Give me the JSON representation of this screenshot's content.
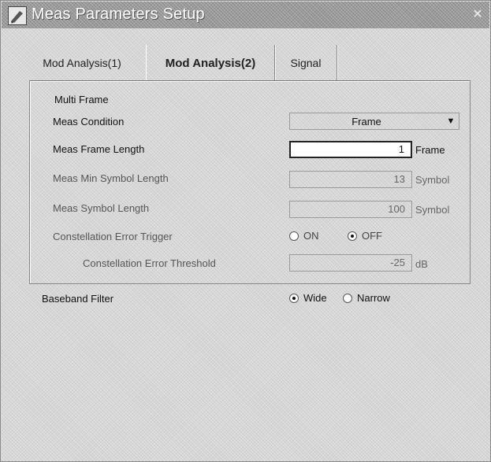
{
  "window": {
    "title": "Meas Parameters Setup",
    "close_glyph": "✕"
  },
  "tabs": [
    {
      "label": "Mod Analysis(1)"
    },
    {
      "label": "Mod Analysis(2)",
      "active": true
    },
    {
      "label": "Signal"
    }
  ],
  "group": {
    "title": "Multi Frame",
    "meas_condition": {
      "label": "Meas Condition",
      "value": "Frame"
    },
    "frame_length": {
      "label": "Meas Frame Length",
      "value": "1",
      "unit": "Frame"
    },
    "min_symbol_length": {
      "label": "Meas Min Symbol Length",
      "value": "13",
      "unit": "Symbol"
    },
    "symbol_length": {
      "label": "Meas Symbol Length",
      "value": "100",
      "unit": "Symbol"
    },
    "constellation_trigger": {
      "label": "Constellation Error Trigger",
      "options": [
        {
          "label": "ON",
          "selected": false
        },
        {
          "label": "OFF",
          "selected": true
        }
      ]
    },
    "constellation_threshold": {
      "label": "Constellation Error Threshold",
      "value": "-25",
      "unit": "dB"
    }
  },
  "baseband_filter": {
    "label": "Baseband Filter",
    "options": [
      {
        "label": "Wide",
        "selected": true
      },
      {
        "label": "Narrow",
        "selected": false
      }
    ]
  },
  "icons": {
    "app": "app-pen-icon",
    "dropdown": "chevron-down-icon",
    "close": "close-icon"
  }
}
